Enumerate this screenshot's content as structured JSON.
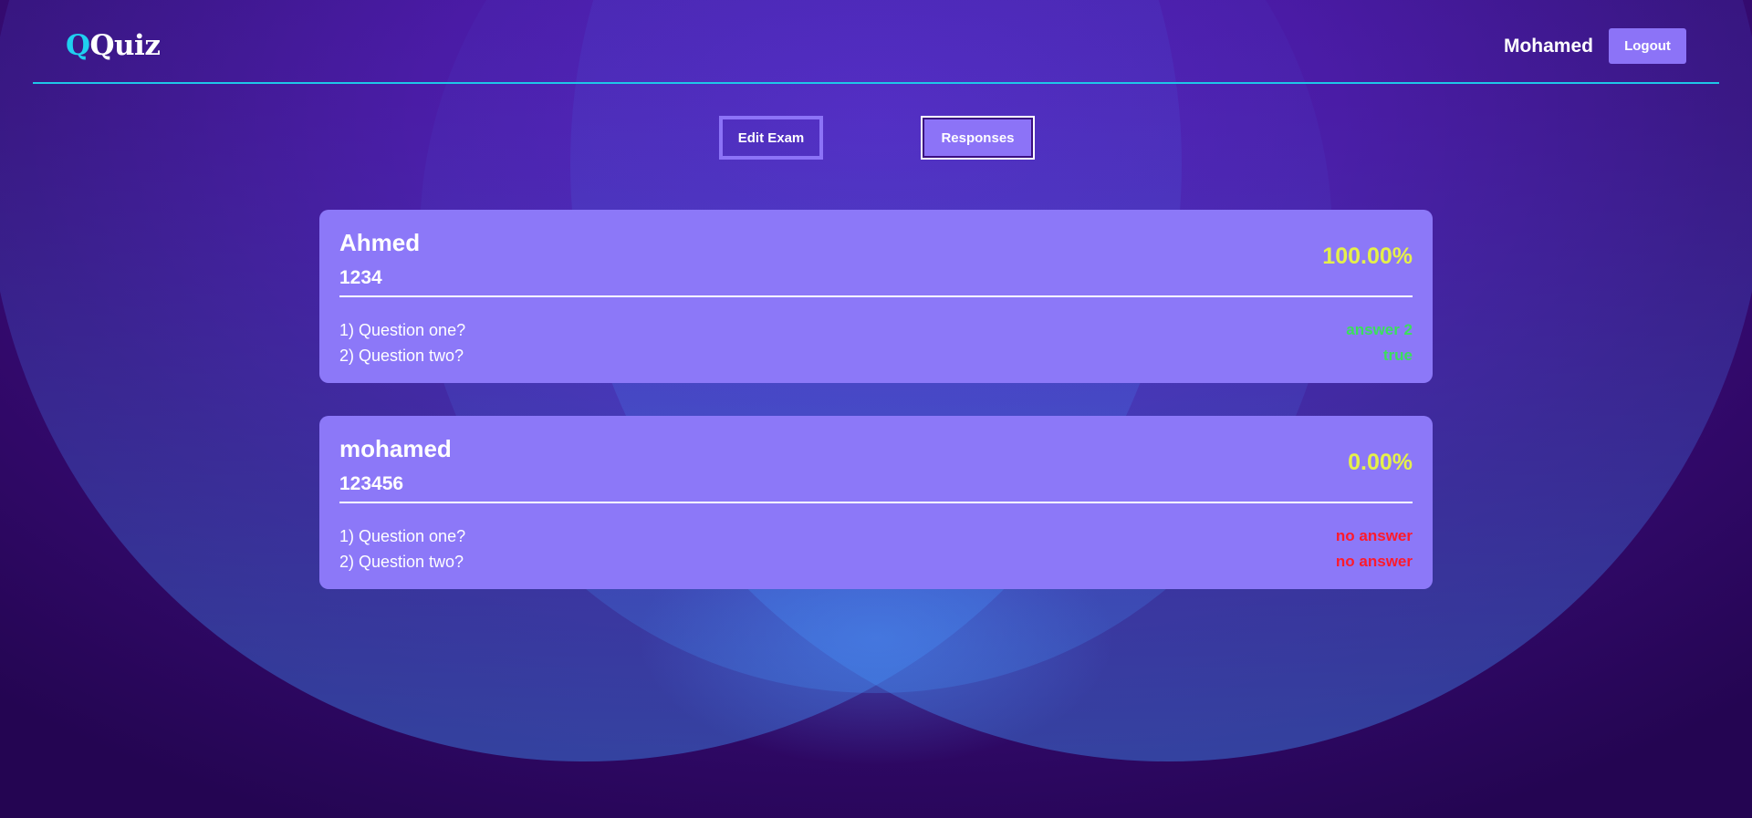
{
  "app": {
    "logo_q": "Q",
    "logo_rest": "Quiz"
  },
  "header": {
    "user_name": "Mohamed",
    "logout_label": "Logout"
  },
  "tabs": {
    "edit_exam": "Edit Exam",
    "responses": "Responses",
    "active": "responses"
  },
  "responses": [
    {
      "name": "Ahmed",
      "id": "1234",
      "score": "100.00%",
      "answers": [
        {
          "question": "1) Question one?",
          "answer": "answer 2",
          "status": "correct"
        },
        {
          "question": "2) Question two?",
          "answer": "true",
          "status": "correct"
        }
      ]
    },
    {
      "name": "mohamed",
      "id": "123456",
      "score": "0.00%",
      "answers": [
        {
          "question": "1) Question one?",
          "answer": "no answer",
          "status": "none"
        },
        {
          "question": "2) Question two?",
          "answer": "no answer",
          "status": "none"
        }
      ]
    }
  ],
  "colors": {
    "accent": "#8c73f7",
    "header_line": "#1fc7e8",
    "score": "#e5f04a",
    "correct": "#3bdf5c",
    "no_answer": "#ff1a2b",
    "card": "#8c78f8"
  }
}
